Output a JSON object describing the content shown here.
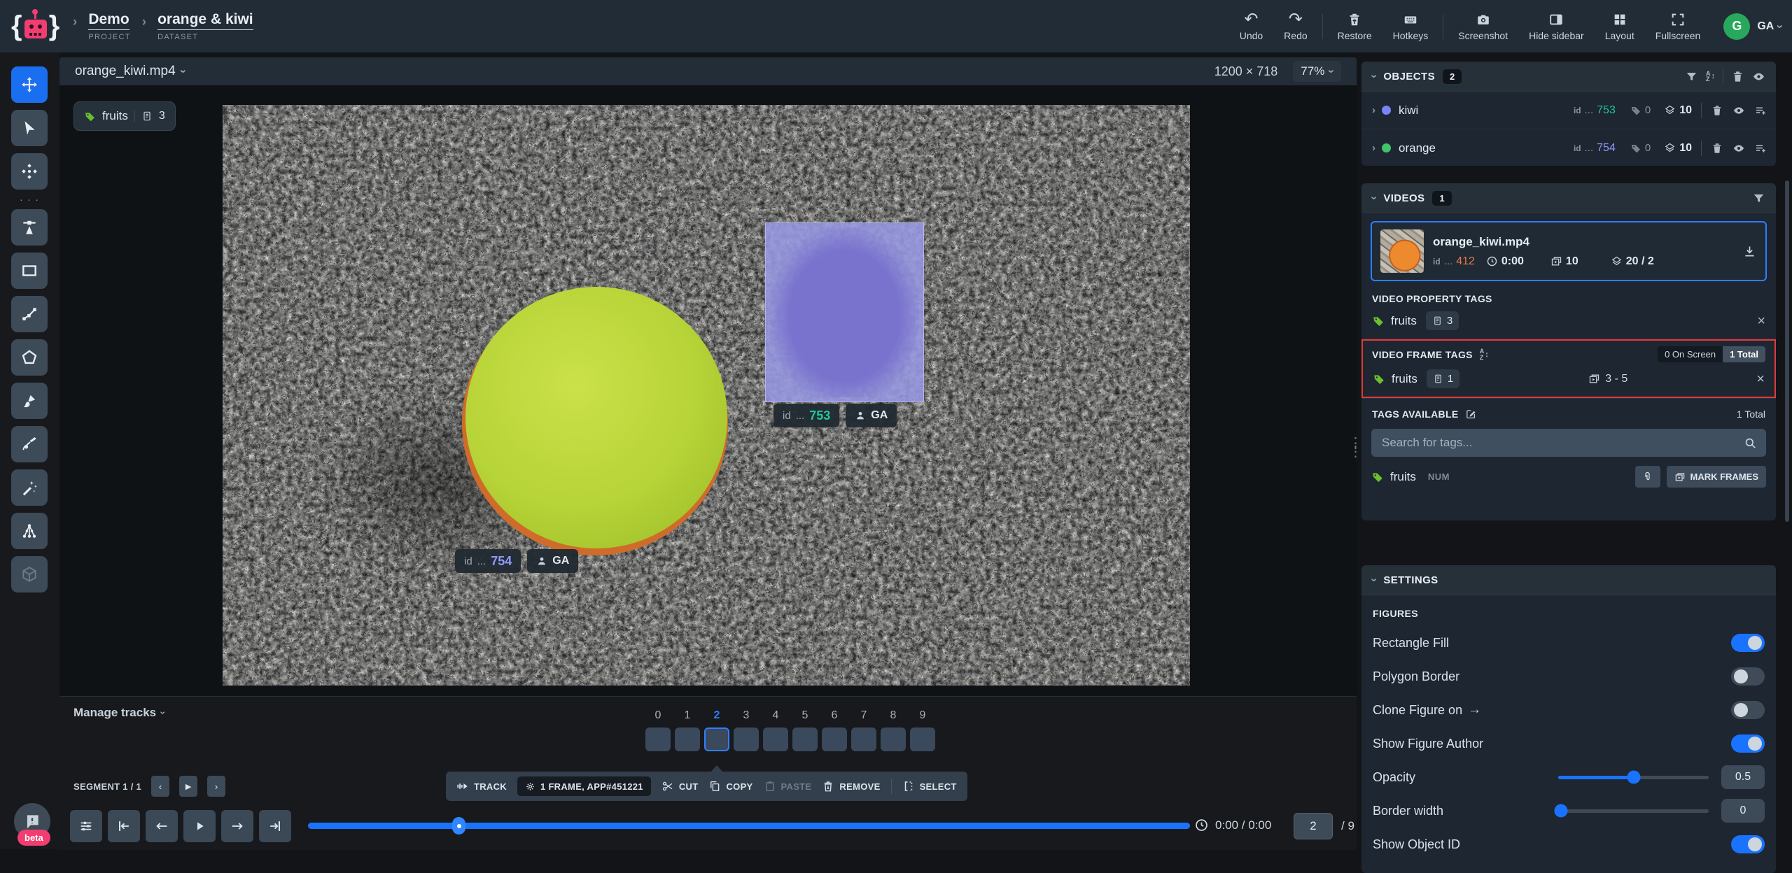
{
  "icons": {
    "caret": "›",
    "undo": "↶",
    "redo": "↷",
    "close": "×",
    "dots": "· · ·",
    "arrow_right": "→",
    "play_small": "▶",
    "chev_left": "‹",
    "chev_right": "›",
    "handle": "⋮",
    "updown": "↕",
    "sort_a": "A",
    "sort_z": "Z"
  },
  "colors": {
    "accent_blue": "#1a73ff",
    "pink": "#f23d71",
    "avatar_green": "#27a85c",
    "tag_green": "#6cbe2e",
    "danger_red": "#df3b3b",
    "id_kiwi": "#1fc89b",
    "id_orange": "#8f9bff",
    "id_video": "#e8794a",
    "dot_kiwi": "#7b84f7",
    "dot_orange": "#3fc46a"
  },
  "topbar": {
    "project": {
      "label": "Demo",
      "type": "PROJECT"
    },
    "dataset": {
      "label": "orange & kiwi",
      "type": "DATASET"
    },
    "actions": [
      {
        "label": "Undo"
      },
      {
        "label": "Redo"
      },
      {
        "label": "Restore"
      },
      {
        "label": "Hotkeys"
      },
      {
        "label": "Screenshot"
      },
      {
        "label": "Hide sidebar"
      },
      {
        "label": "Layout"
      },
      {
        "label": "Fullscreen"
      }
    ],
    "avatar": "G",
    "user": "GA"
  },
  "canvas": {
    "file": "orange_kiwi.mp4",
    "resolution": "1200 × 718",
    "zoom": "77%",
    "video_tag": {
      "name": "fruits",
      "count": "3"
    },
    "labels": {
      "kiwi": {
        "id_label": "id",
        "ellipsis": "...",
        "id": "753",
        "author": "GA"
      },
      "orange": {
        "id_label": "id",
        "ellipsis": "...",
        "id": "754",
        "author": "GA"
      }
    }
  },
  "objects": {
    "title": "OBJECTS",
    "count": "2",
    "rows": [
      {
        "name": "kiwi",
        "id_label": "id",
        "ellipsis": "...",
        "id": "753",
        "tags": "0",
        "figures": "10"
      },
      {
        "name": "orange",
        "id_label": "id",
        "ellipsis": "...",
        "id": "754",
        "tags": "0",
        "figures": "10"
      }
    ]
  },
  "videos": {
    "title": "VIDEOS",
    "count": "1",
    "item": {
      "name": "orange_kiwi.mp4",
      "id_label": "id",
      "ellipsis": "...",
      "id": "412",
      "duration": "0:00",
      "frames": "10",
      "figures": "20 / 2"
    },
    "property_tags": {
      "title": "VIDEO PROPERTY TAGS",
      "tag": {
        "name": "fruits",
        "count": "3"
      }
    },
    "frame_tags": {
      "title": "VIDEO FRAME TAGS",
      "on_screen": "0 On Screen",
      "total": "1 Total",
      "tag": {
        "name": "fruits",
        "count": "1",
        "range": "3 - 5"
      }
    },
    "tags_available": {
      "title": "TAGS AVAILABLE",
      "total": "1 Total",
      "search_placeholder": "Search for tags...",
      "tag": {
        "name": "fruits",
        "type": "NUM",
        "mark_frames": "MARK FRAMES"
      }
    }
  },
  "settings": {
    "title": "SETTINGS",
    "section": "FIGURES",
    "toggles": [
      {
        "label": "Rectangle Fill"
      },
      {
        "label": "Polygon Border"
      },
      {
        "label": "Clone Figure on"
      },
      {
        "label": "Show Figure Author"
      }
    ],
    "opacity": {
      "label": "Opacity",
      "value": "0.5"
    },
    "border_width": {
      "label": "Border width",
      "value": "0"
    },
    "partial": {
      "label": "Show Object ID"
    }
  },
  "timeline": {
    "manage": "Manage tracks",
    "frames": [
      "0",
      "1",
      "2",
      "3",
      "4",
      "5",
      "6",
      "7",
      "8",
      "9"
    ],
    "segment": "SEGMENT 1 / 1",
    "track": {
      "label": "TRACK",
      "info": "1 FRAME, APP#451221",
      "cut": "CUT",
      "copy": "COPY",
      "paste": "PASTE",
      "remove": "REMOVE",
      "select": "SELECT"
    },
    "time": "0:00 / 0:00",
    "frame_value": "2",
    "frame_total": "/ 9"
  },
  "beta": "beta"
}
